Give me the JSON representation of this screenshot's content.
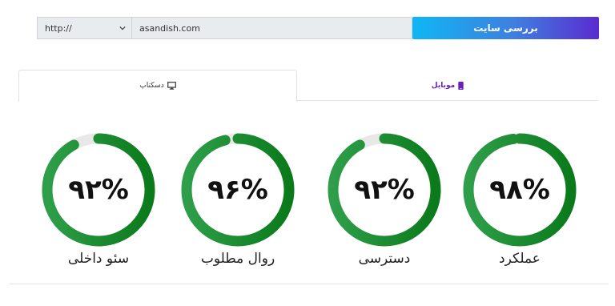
{
  "url_bar": {
    "protocol": "http://",
    "url": "asandish.com",
    "submit_label": "بررسی سایت"
  },
  "tabs": [
    {
      "label": "دسکتاپ",
      "icon": "monitor-icon",
      "active": true
    },
    {
      "label": "موبایل",
      "icon": "mobile-icon",
      "active": false,
      "color": "#6a1fb8"
    }
  ],
  "gauges": [
    {
      "label": "سئو داخلی",
      "value": 92,
      "display": "۹۲%"
    },
    {
      "label": "روال مطلوب",
      "value": 96,
      "display": "۹۶%"
    },
    {
      "label": "دسترسی",
      "value": 92,
      "display": "۹۲%"
    },
    {
      "label": "عملکرد",
      "value": 98,
      "display": "۹۸%"
    }
  ],
  "colors": {
    "gauge_fill_top": "#2e9e4a",
    "gauge_fill_bottom": "#0b7a1b",
    "gauge_track": "#e8e8e8",
    "button_gradient": [
      "#0fb6f4",
      "#5a2bd0"
    ]
  }
}
